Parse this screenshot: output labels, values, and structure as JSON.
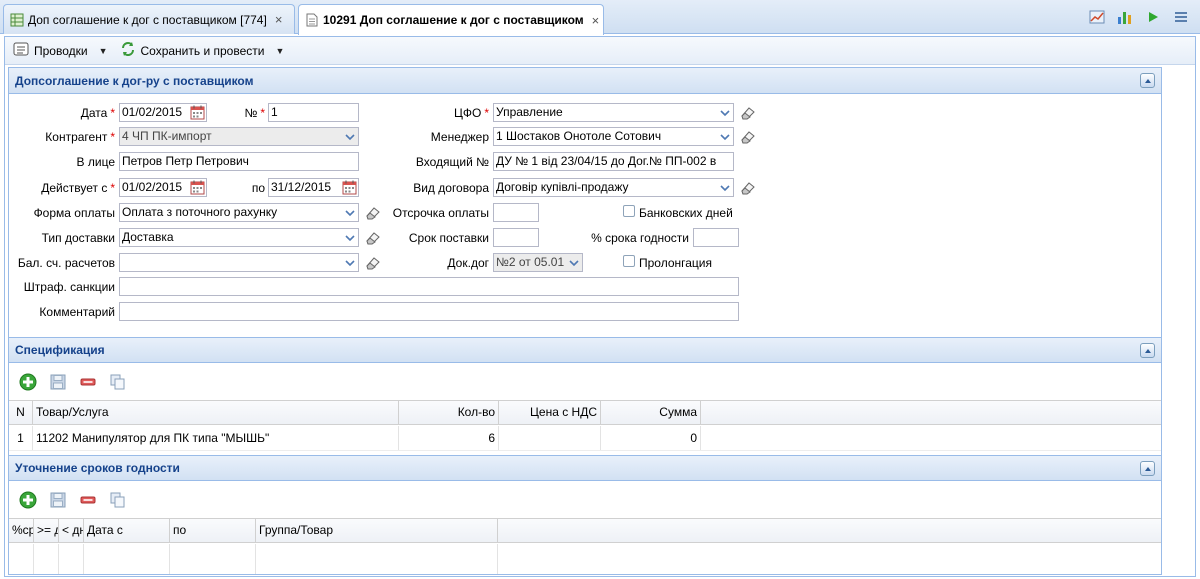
{
  "tabs": [
    {
      "label": "Доп соглашение к дог с поставщиком [774]"
    },
    {
      "label": "10291 Доп соглашение к дог с поставщиком"
    }
  ],
  "tab_close": "×",
  "toolbar": {
    "postings_label": "Проводки",
    "save_post_label": "Сохранить и провести",
    "caret": "▼"
  },
  "form_panel": {
    "title": "Допсоглашение к дог-ру с поставщиком",
    "date_label": "Дата",
    "date_value": "01/02/2015",
    "number_label": "№",
    "number_value": "1",
    "cfo_label": "ЦФО",
    "cfo_value": "Управление",
    "counterparty_label": "Контрагент",
    "counterparty_value": "4 ЧП ПК-импорт",
    "manager_label": "Менеджер",
    "manager_value": "1 Шостаков Онотоле Сотович",
    "person_label": "В лице",
    "person_value": "Петров Петр Петрович",
    "incoming_label": "Входящий №",
    "incoming_value": "ДУ № 1 від 23/04/15 до Дог.№ ПП-002 в",
    "valid_from_label": "Действует с",
    "valid_from_value": "01/02/2015",
    "to_label": "по",
    "valid_to_value": "31/12/2015",
    "contract_type_label": "Вид договора",
    "contract_type_value": "Договір купівлі-продажу",
    "payment_form_label": "Форма оплаты",
    "payment_form_value": "Оплата з поточного рахунку",
    "deferral_label": "Отсрочка оплаты",
    "bank_days_label": "Банковских дней",
    "delivery_type_label": "Тип доставки",
    "delivery_type_value": "Доставка",
    "delivery_term_label": "Срок поставки",
    "shelf_life_label": "% срока годности",
    "balance_label": "Бал. сч. расчетов",
    "contract_doc_label": "Док.дог",
    "contract_doc_value": "№2 от 05.01",
    "prolongation_label": "Пролонгация",
    "penalty_label": "Штраф. санкции",
    "comment_label": "Комментарий",
    "required_mark": "*"
  },
  "spec_panel": {
    "title": "Спецификация",
    "columns": [
      "N",
      "Товар/Услуга",
      "Кол-во",
      "Цена с НДС",
      "Сумма"
    ],
    "rows": [
      {
        "n": "1",
        "item": "11202 Манипулятор для ПК типа \"МЫШЬ\"",
        "qty": "6",
        "price": "",
        "sum": "0"
      }
    ]
  },
  "shelf_panel": {
    "title": "Уточнение сроков годности",
    "columns": [
      "%ср",
      ">= д",
      "< дн",
      "Дата с",
      "по",
      "Группа/Товар"
    ]
  },
  "icon_names": [
    "table-icon",
    "doc-icon",
    "chart-icon",
    "bar-chart-icon",
    "play-icon",
    "list-icon",
    "refresh-icon",
    "calendar-icon",
    "eraser-icon",
    "chevron-down-icon",
    "collapse-up-icon",
    "add-icon",
    "save-icon",
    "delete-icon",
    "copy-icon"
  ],
  "colors": {
    "header_text": "#15428b",
    "border": "#99bbe8",
    "required": "#dd0000",
    "add_green": "#2e9a2e",
    "delete_red": "#cc3333"
  }
}
